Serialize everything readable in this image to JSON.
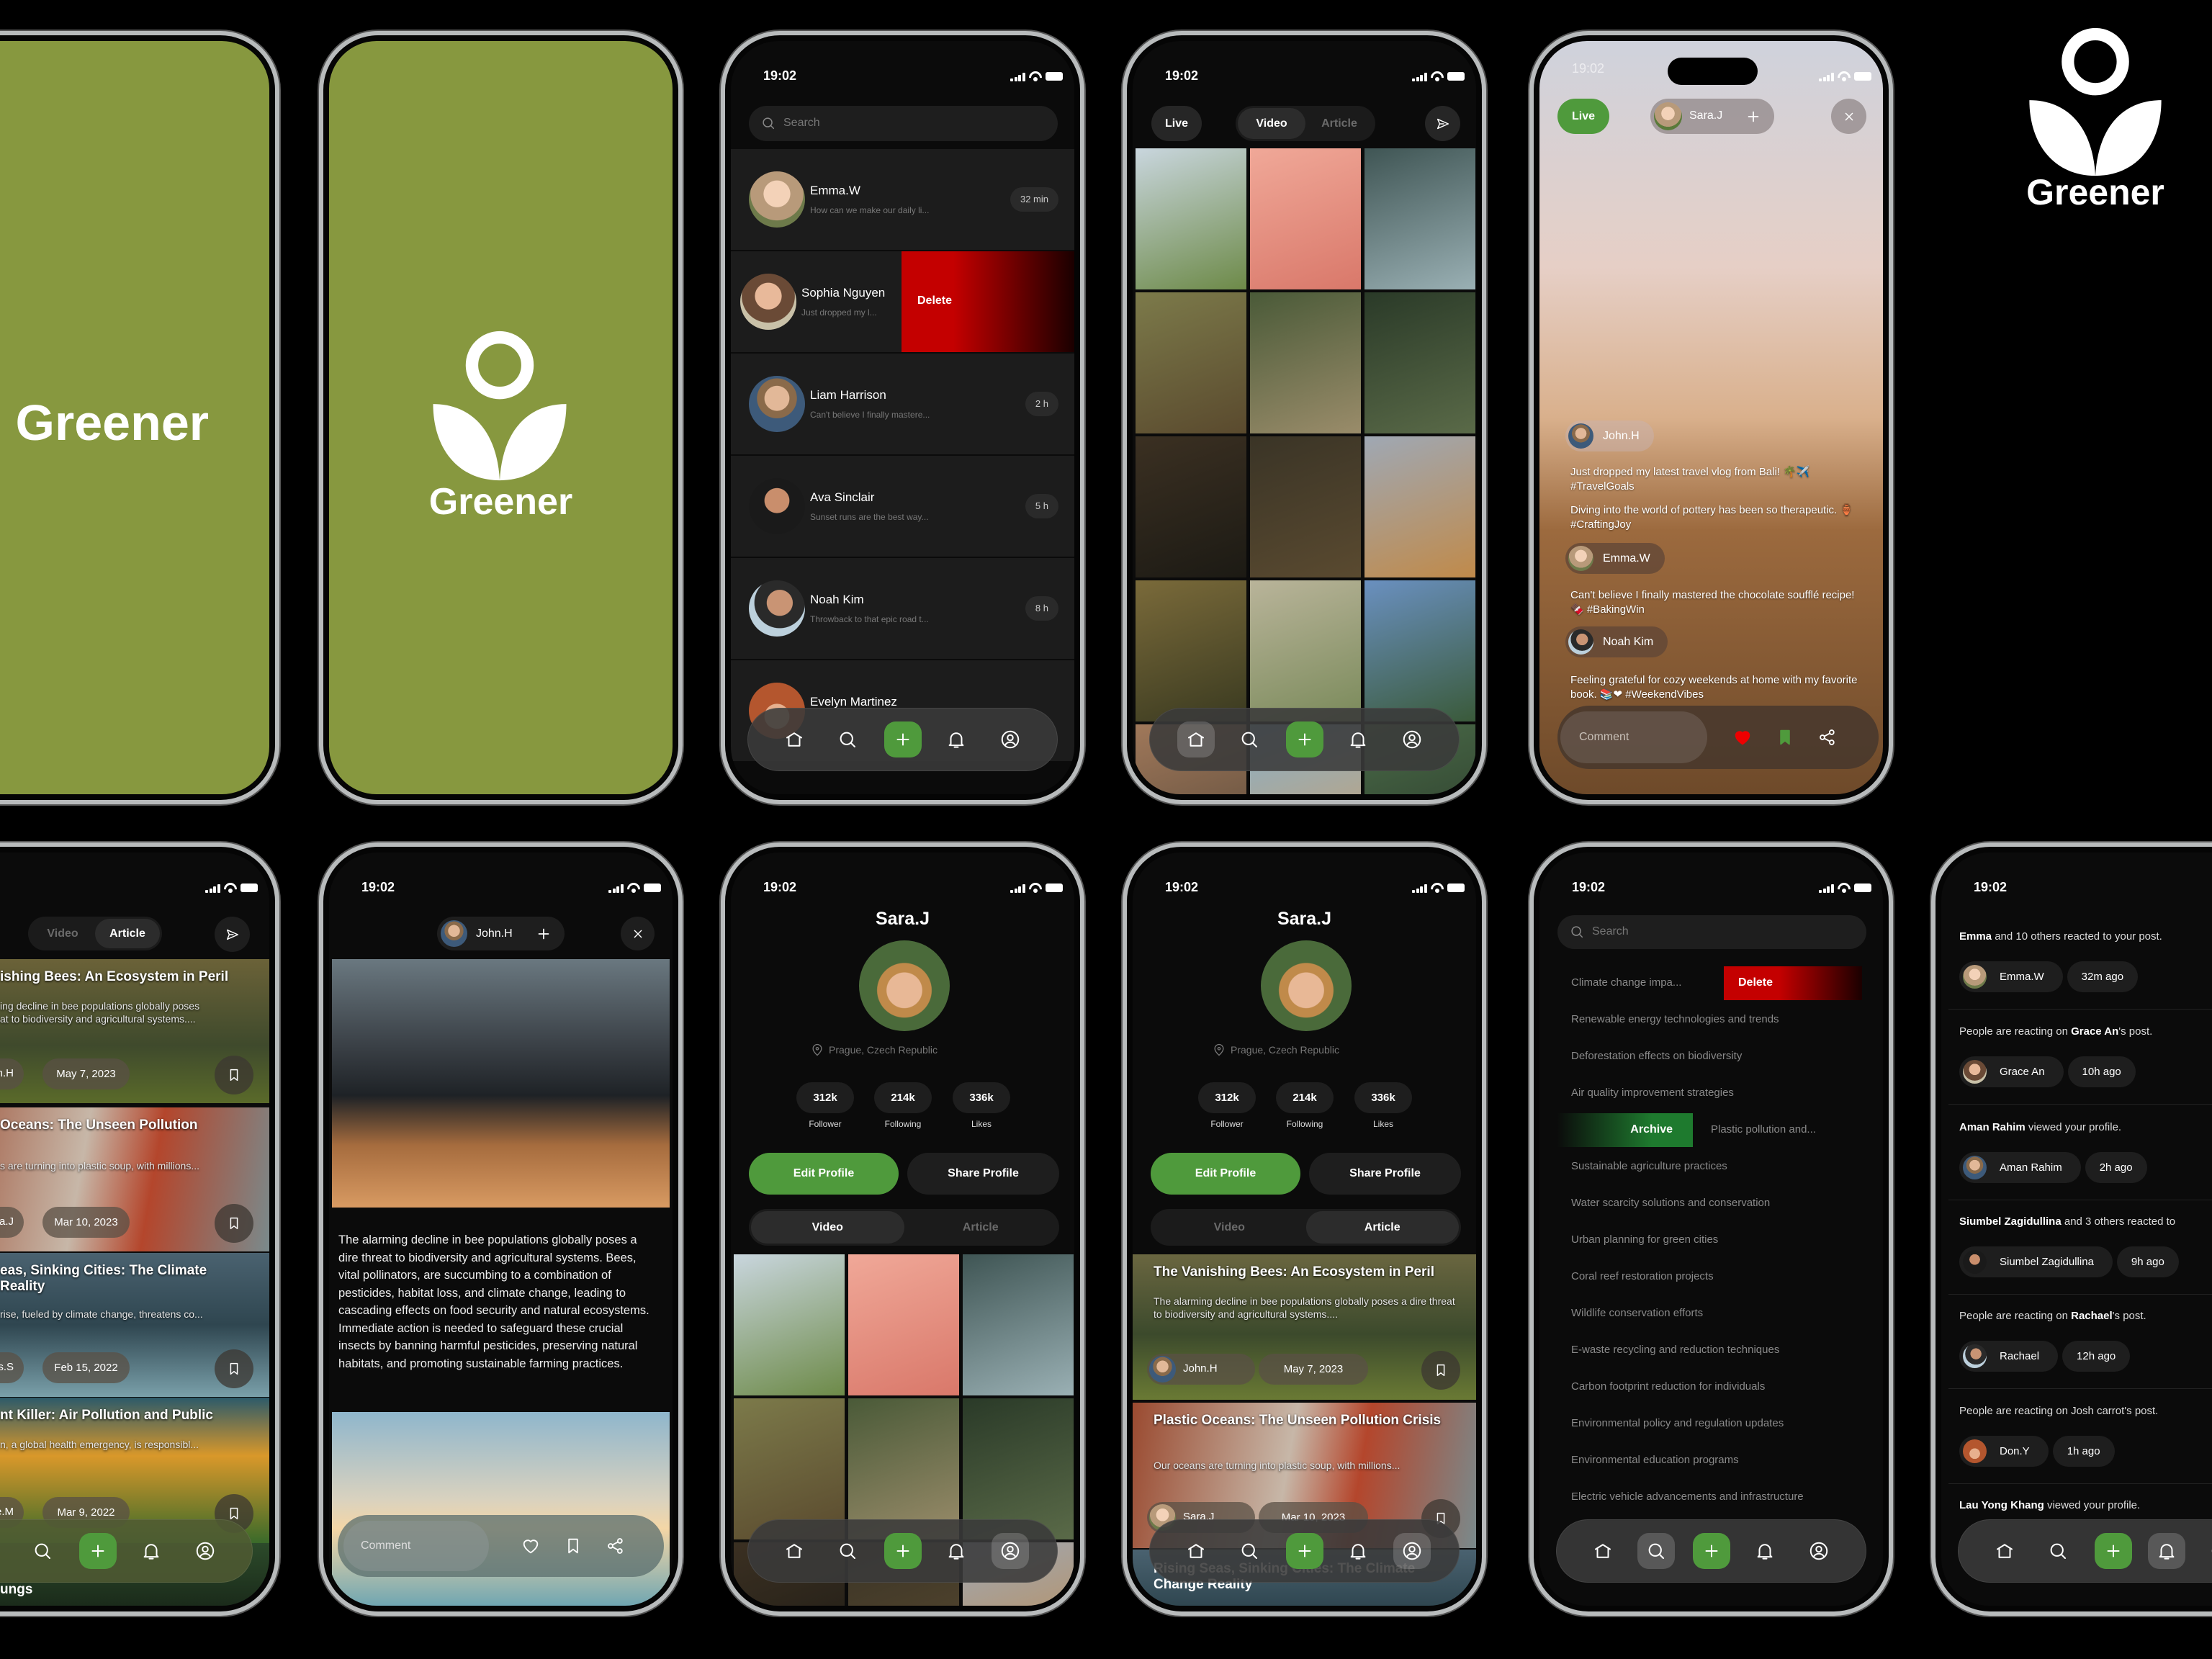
{
  "brand": {
    "name": "Greener",
    "green": "#87983f",
    "accent": "#4f9a3c",
    "danger": "#cc0000"
  },
  "status_time": "19:02",
  "nav": {
    "icons": [
      "home-icon",
      "search-icon",
      "plus-icon",
      "bell-icon",
      "user-icon"
    ]
  },
  "messages": {
    "search_placeholder": "Search",
    "delete_label": "Delete",
    "items": [
      {
        "name": "Emma.W",
        "preview": "How can we make our daily li...",
        "time": "32 min"
      },
      {
        "name": "Sophia Nguyen",
        "preview": "Just dropped my l...",
        "time": ""
      },
      {
        "name": "Liam Harrison",
        "preview": "Can't believe I finally mastere...",
        "time": "2 h"
      },
      {
        "name": "Ava Sinclair",
        "preview": "Sunset runs are the best way...",
        "time": "5 h"
      },
      {
        "name": "Noah Kim",
        "preview": "Throwback to that epic road t...",
        "time": "8 h"
      },
      {
        "name": "Evelyn Martinez",
        "preview": "",
        "time": ""
      }
    ]
  },
  "feed": {
    "live_label": "Live",
    "tabs": [
      "Video",
      "Article"
    ]
  },
  "live": {
    "live_label": "Live",
    "host": "Sara.J",
    "comment_placeholder": "Comment",
    "comments": [
      {
        "user": "John.H",
        "lines": [
          "Just dropped my latest travel vlog from Bali! 🌴✈️ #TravelGoals",
          "Diving into the world of pottery has been so therapeutic. 🏺 #CraftingJoy"
        ]
      },
      {
        "user": "Emma.W",
        "lines": [
          "Can't believe I finally mastered the chocolate soufflé recipe! 🍫 #BakingWin"
        ]
      },
      {
        "user": "Noah Kim",
        "lines": [
          "Feeling grateful for cozy weekends at home with my favorite book. 📚❤ #WeekendVibes"
        ]
      }
    ]
  },
  "article_list": {
    "tabs": [
      "Video",
      "Article"
    ],
    "cards": [
      {
        "title": "ishing Bees: An Ecosystem in Peril",
        "excerpt": "ing decline in bee populations globally poses\nat to biodiversity and agricultural systems....",
        "author": "hn.H",
        "date": "May 7, 2023"
      },
      {
        "title": "Oceans: The Unseen Pollution",
        "excerpt": "s are turning into plastic soup, with millions...",
        "author": "ra.J",
        "date": "Mar 10, 2023"
      },
      {
        "title": "eas, Sinking Cities: The Climate\n Reality",
        "excerpt": "rise, fueled by climate change, threatens co...",
        "author": "mes.S",
        "date": "Feb 15, 2022"
      },
      {
        "title": "nt Killer: Air Pollution and Public",
        "excerpt": "n, a global health emergency, is responsibl...",
        "author": "rie.M",
        "date": "Mar 9, 2022"
      },
      {
        "title": "ungs",
        "excerpt": "",
        "author": "",
        "date": ""
      }
    ]
  },
  "article_detail": {
    "author": "John.H",
    "body": "The alarming decline in bee populations globally poses a dire threat to biodiversity and agricultural systems. Bees, vital pollinators, are succumbing to a combination of pesticides, habitat loss, and climate change, leading to cascading effects on food security and natural ecosystems. Immediate action is needed to safeguard these crucial insects by banning harmful pesticides, preserving natural habitats, and promoting sustainable farming practices.",
    "comment_placeholder": "Comment"
  },
  "profile": {
    "name": "Sara.J",
    "location": "Prague, Czech Republic",
    "stats": [
      {
        "value": "312k",
        "label": "Follower"
      },
      {
        "value": "214k",
        "label": "Following"
      },
      {
        "value": "336k",
        "label": "Likes"
      }
    ],
    "edit_label": "Edit Profile",
    "share_label": "Share Profile",
    "tabs": [
      "Video",
      "Article"
    ],
    "articles": [
      {
        "title": "The Vanishing Bees: An Ecosystem in Peril",
        "excerpt": "The alarming decline in bee populations globally poses a dire threat to biodiversity and agricultural systems....",
        "author": "John.H",
        "date": "May 7, 2023"
      },
      {
        "title": "Plastic Oceans: The Unseen Pollution Crisis",
        "excerpt": "Our oceans are turning into plastic soup, with millions...",
        "author": "Sara.J",
        "date": "Mar 10, 2023"
      },
      {
        "title": "Rising Seas, Sinking Cities: The Climate Change Reality",
        "excerpt": "",
        "author": "",
        "date": ""
      }
    ]
  },
  "search": {
    "placeholder": "Search",
    "delete_label": "Delete",
    "archive_label": "Archive",
    "items": [
      "Climate change impa...",
      "Renewable energy technologies and trends",
      "Deforestation effects on biodiversity",
      "Air quality improvement strategies",
      "Plastic pollution and...",
      "Sustainable agriculture practices",
      "Water scarcity solutions and conservation",
      "Urban planning for green cities",
      "Coral reef restoration projects",
      "Wildlife conservation efforts",
      "E-waste recycling and reduction techniques",
      "Carbon footprint reduction for individuals",
      "Environmental policy and regulation updates",
      "Environmental education programs",
      "Electric vehicle advancements and infrastructure"
    ]
  },
  "notifications": [
    {
      "pre": "",
      "bold": "Emma",
      "post": " and 10 others reacted to your post.",
      "user": "Emma.W",
      "time": "32m ago"
    },
    {
      "pre": "People are reacting on ",
      "bold": "Grace An",
      "post": "'s post.",
      "user": "Grace An",
      "time": "10h ago"
    },
    {
      "pre": "",
      "bold": "Aman Rahim",
      "post": " viewed your profile.",
      "user": "Aman Rahim",
      "time": "2h ago"
    },
    {
      "pre": "",
      "bold": "Siumbel Zagidullina",
      "post": " and 3 others reacted to",
      "user": "Siumbel Zagidullina",
      "time": "9h ago"
    },
    {
      "pre": "People are reacting on ",
      "bold": "Rachael",
      "post": "'s post.",
      "user": "Rachael",
      "time": "12h ago"
    },
    {
      "pre": "People are reacting on Josh carrot's post.",
      "bold": "",
      "post": "",
      "user": "Don.Y",
      "time": "1h ago"
    },
    {
      "pre": "",
      "bold": "Lau Yong Khang",
      "post": " viewed your profile.",
      "user": "",
      "time": ""
    }
  ]
}
